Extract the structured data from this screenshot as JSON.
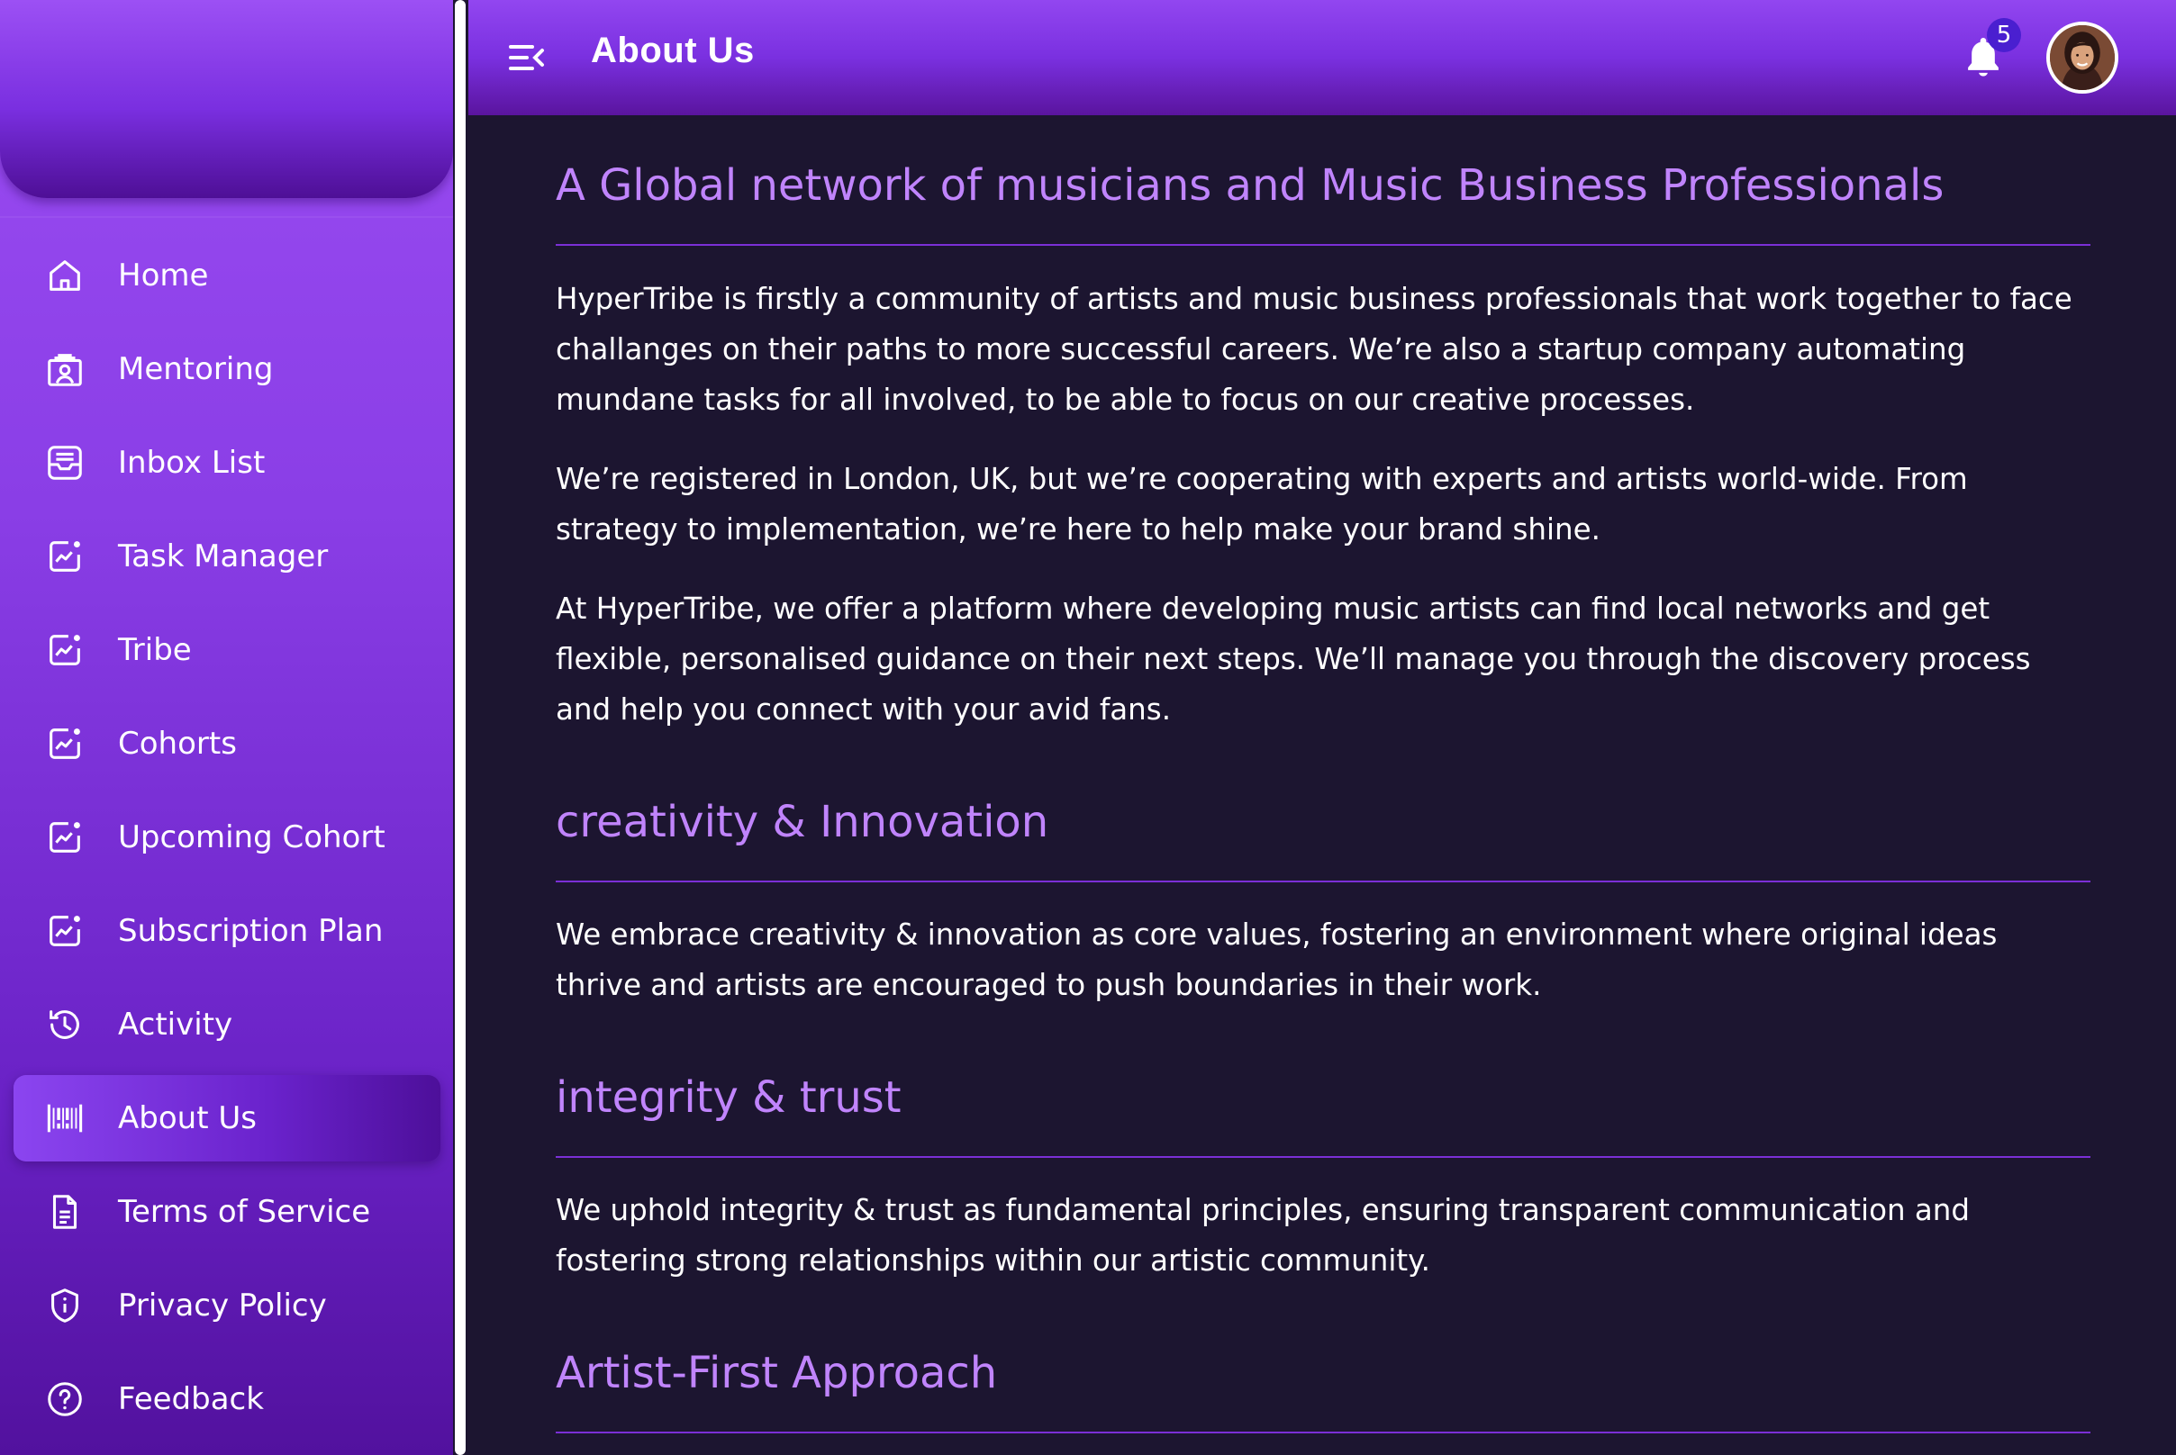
{
  "header": {
    "title": "About Us",
    "notification_count": "5"
  },
  "sidebar": {
    "items": [
      {
        "label": "Home",
        "icon": "home-icon"
      },
      {
        "label": "Mentoring",
        "icon": "mentoring-icon"
      },
      {
        "label": "Inbox List",
        "icon": "inbox-icon"
      },
      {
        "label": "Task Manager",
        "icon": "chart-icon"
      },
      {
        "label": "Tribe",
        "icon": "chart-icon"
      },
      {
        "label": "Cohorts",
        "icon": "chart-icon"
      },
      {
        "label": "Upcoming Cohort",
        "icon": "chart-icon"
      },
      {
        "label": "Subscription Plan",
        "icon": "chart-icon"
      },
      {
        "label": "Activity",
        "icon": "history-icon"
      },
      {
        "label": "About Us",
        "icon": "barcode-icon",
        "active": true
      },
      {
        "label": "Terms of Service",
        "icon": "document-icon"
      },
      {
        "label": "Privacy Policy",
        "icon": "shield-icon"
      },
      {
        "label": "Feedback",
        "icon": "help-icon"
      }
    ]
  },
  "content": {
    "sections": [
      {
        "title": "A Global network of musicians and Music Business Professionals",
        "paragraphs": [
          "HyperTribe is firstly a community of artists and music business professionals that work together to face challanges on their paths to more successful careers. We’re also a startup company automating mundane tasks for all involved, to be able to focus on our creative processes.",
          "We’re registered in London, UK, but we’re cooperating with experts and artists world-wide. From strategy to implementation, we’re here to help make your brand shine.",
          "At HyperTribe, we offer a platform where developing music artists can find local networks and get flexible, personalised guidance on their next steps. We’ll manage you through the discovery process and help you connect with your avid fans."
        ]
      },
      {
        "title": "creativity & Innovation",
        "paragraphs": [
          "We embrace creativity & innovation as core values, fostering an environment where original ideas thrive and artists are encouraged to push boundaries in their work."
        ]
      },
      {
        "title": "integrity & trust",
        "paragraphs": [
          "We uphold integrity & trust as fundamental principles, ensuring transparent communication and fostering strong relationships within our artistic community."
        ]
      },
      {
        "title": "Artist-First Approach",
        "paragraphs": []
      }
    ]
  },
  "colors": {
    "sidebar_top": "#9a4cf2",
    "sidebar_bottom": "#52119e",
    "content_bg": "#1c1530",
    "accent_title": "#c084fc",
    "rule": "#7b2fd6",
    "badge": "#4a1fd0"
  }
}
